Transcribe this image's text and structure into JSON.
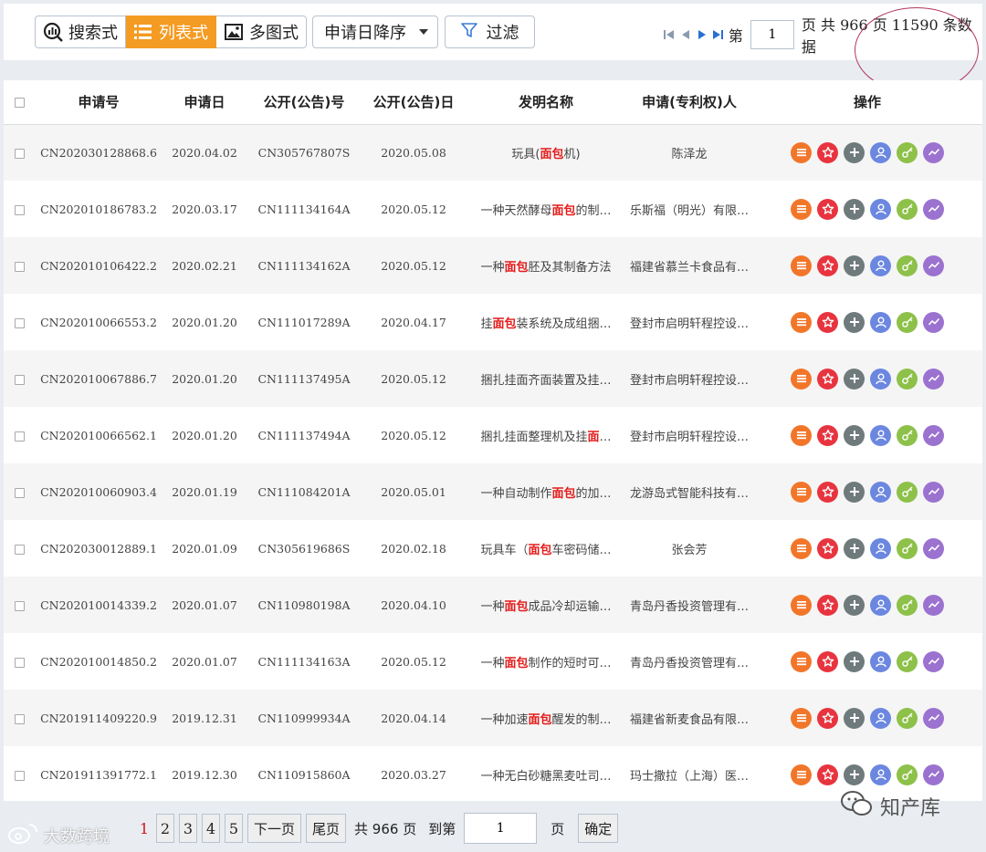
{
  "toolbar": {
    "views": [
      {
        "label": "搜索式",
        "icon": "search-chart-icon"
      },
      {
        "label": "列表式",
        "icon": "list-icon"
      },
      {
        "label": "多图式",
        "icon": "image-icon"
      }
    ],
    "sort_label": "申请日降序",
    "filter_label": "过滤"
  },
  "pager_top": {
    "prefix": "第",
    "page_value": "1",
    "suffix": "页 共 966 页 11590 条数据"
  },
  "table": {
    "headers": [
      "申请号",
      "申请日",
      "公开(公告)号",
      "公开(公告)日",
      "发明名称",
      "申请(专利权)人",
      "操作"
    ],
    "rows": [
      {
        "app_no": "CN202030128868.6",
        "app_date": "2020.04.02",
        "pub_no": "CN305767807S",
        "pub_date": "2020.05.08",
        "t1": "玩具(",
        "hl": "面包",
        "t2": "机)",
        "applicant": "陈泽龙"
      },
      {
        "app_no": "CN202010186783.2",
        "app_date": "2020.03.17",
        "pub_no": "CN111134164A",
        "pub_date": "2020.05.12",
        "t1": "一种天然酵母",
        "hl": "面包",
        "t2": "的制…",
        "applicant": "乐斯福（明光）有限…"
      },
      {
        "app_no": "CN202010106422.2",
        "app_date": "2020.02.21",
        "pub_no": "CN111134162A",
        "pub_date": "2020.05.12",
        "t1": "一种",
        "hl": "面包",
        "t2": "胚及其制备方法",
        "applicant": "福建省慕兰卡食品有…"
      },
      {
        "app_no": "CN202010066553.2",
        "app_date": "2020.01.20",
        "pub_no": "CN111017289A",
        "pub_date": "2020.04.17",
        "t1": "挂",
        "hl": "面包",
        "t2": "装系统及成组捆…",
        "applicant": "登封市启明轩程控设…"
      },
      {
        "app_no": "CN202010067886.7",
        "app_date": "2020.01.20",
        "pub_no": "CN111137495A",
        "pub_date": "2020.05.12",
        "t1": "捆扎挂面齐面装置及挂…",
        "hl": "",
        "t2": "",
        "applicant": "登封市启明轩程控设…"
      },
      {
        "app_no": "CN202010066562.1",
        "app_date": "2020.01.20",
        "pub_no": "CN111137494A",
        "pub_date": "2020.05.12",
        "t1": "捆扎挂面整理机及挂",
        "hl": "面",
        "t2": "…",
        "applicant": "登封市启明轩程控设…"
      },
      {
        "app_no": "CN202010060903.4",
        "app_date": "2020.01.19",
        "pub_no": "CN111084201A",
        "pub_date": "2020.05.01",
        "t1": "一种自动制作",
        "hl": "面包",
        "t2": "的加…",
        "applicant": "龙游岛式智能科技有…"
      },
      {
        "app_no": "CN202030012889.1",
        "app_date": "2020.01.09",
        "pub_no": "CN305619686S",
        "pub_date": "2020.02.18",
        "t1": "玩具车（",
        "hl": "面包",
        "t2": "车密码储…",
        "applicant": "张会芳"
      },
      {
        "app_no": "CN202010014339.2",
        "app_date": "2020.01.07",
        "pub_no": "CN110980198A",
        "pub_date": "2020.04.10",
        "t1": "一种",
        "hl": "面包",
        "t2": "成品冷却运输…",
        "applicant": "青岛丹香投资管理有…"
      },
      {
        "app_no": "CN202010014850.2",
        "app_date": "2020.01.07",
        "pub_no": "CN111134163A",
        "pub_date": "2020.05.12",
        "t1": "一种",
        "hl": "面包",
        "t2": "制作的短时可…",
        "applicant": "青岛丹香投资管理有…"
      },
      {
        "app_no": "CN201911409220.9",
        "app_date": "2019.12.31",
        "pub_no": "CN110999934A",
        "pub_date": "2020.04.14",
        "t1": "一种加速",
        "hl": "面包",
        "t2": "醒发的制…",
        "applicant": "福建省新麦食品有限…"
      },
      {
        "app_no": "CN201911391772.1",
        "app_date": "2019.12.30",
        "pub_no": "CN110915860A",
        "pub_date": "2020.03.27",
        "t1": "一种无白砂糖黑麦吐司…",
        "hl": "",
        "t2": "",
        "applicant": "玛士撒拉（上海）医…"
      }
    ]
  },
  "ops": [
    {
      "name": "detail-icon",
      "color": "#f2762a"
    },
    {
      "name": "star-icon",
      "color": "#e8343f"
    },
    {
      "name": "plus-icon",
      "color": "#6f7a7c"
    },
    {
      "name": "person-icon",
      "color": "#6b87e0"
    },
    {
      "name": "key-icon",
      "color": "#8dc14a"
    },
    {
      "name": "trend-icon",
      "color": "#9b72cf"
    }
  ],
  "pager_bottom": {
    "current": "1",
    "pages": [
      "2",
      "3",
      "4",
      "5"
    ],
    "next_label": "下一页",
    "last_label": "尾页",
    "total_label": "共 966 页",
    "goto_label": "到第",
    "goto_value": "1",
    "goto_suffix": "页",
    "confirm_label": "确定"
  },
  "watermarks": {
    "left": "大数跨境",
    "right": "知产库"
  }
}
